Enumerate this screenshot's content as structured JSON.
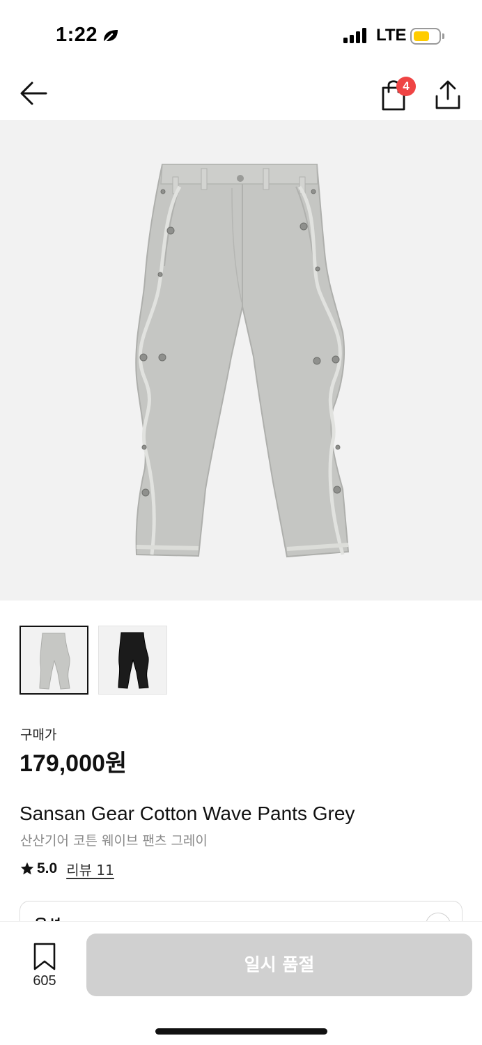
{
  "status_bar": {
    "time": "1:22",
    "network": "LTE",
    "battery_color": "#ffcc00"
  },
  "nav": {
    "back_icon": "arrow-left-icon",
    "bag_icon": "shopping-bag-icon",
    "bag_count": "4",
    "share_icon": "share-upload-icon"
  },
  "product": {
    "main_image": "grey-wave-pants",
    "thumbnails": [
      {
        "name": "grey-pants-thumbnail",
        "selected": true
      },
      {
        "name": "black-pants-thumbnail",
        "selected": false
      }
    ],
    "price_label": "구매가",
    "price": "179,000원",
    "title_en": "Sansan Gear Cotton Wave Pants Grey",
    "title_ko": "산산기어 코튼 웨이브 팬츠 그레이",
    "rating": "5.0",
    "reviews_label": "리뷰 11"
  },
  "option": {
    "label": "옵션"
  },
  "bottom_bar": {
    "wishlist_count": "605",
    "action_label": "일시 품절",
    "action_bg": "#d0d0d0"
  }
}
